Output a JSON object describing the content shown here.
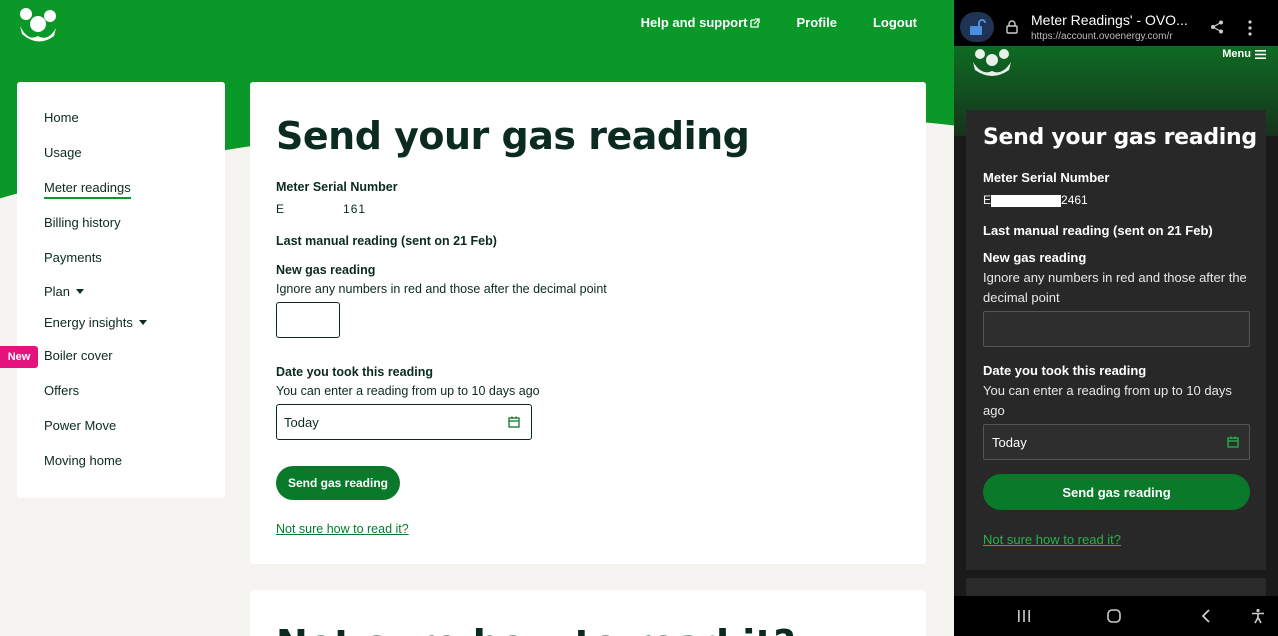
{
  "desktop": {
    "topnav": {
      "help": "Help and support",
      "profile": "Profile",
      "logout": "Logout"
    },
    "sidebar": {
      "items": [
        {
          "label": "Home"
        },
        {
          "label": "Usage"
        },
        {
          "label": "Meter readings"
        },
        {
          "label": "Billing history"
        },
        {
          "label": "Payments"
        },
        {
          "label": "Plan"
        },
        {
          "label": "Energy insights"
        },
        {
          "label": "Boiler cover"
        },
        {
          "label": "Offers"
        },
        {
          "label": "Power Move"
        },
        {
          "label": "Moving home"
        }
      ],
      "new_badge": "New"
    },
    "main": {
      "title": "Send your gas reading",
      "serial_label": "Meter Serial Number",
      "serial_start": "E",
      "serial_end": "161",
      "last_reading": "Last manual reading (sent on 21 Feb)",
      "new_reading_label": "New gas reading",
      "new_reading_hint": "Ignore any numbers in red and those after the decimal point",
      "date_label": "Date you took this reading",
      "date_hint": "You can enter a reading from up to 10 days ago",
      "date_value": "Today",
      "send_button": "Send gas reading",
      "help_link": "Not sure how to read it?",
      "next_card_title": "Not sure how to read it?"
    }
  },
  "mobile": {
    "browser": {
      "tab_title": "Meter Readings' - OVO...",
      "url": "https://account.ovoenergy.com/r"
    },
    "menu_label": "Menu",
    "main": {
      "title": "Send your gas reading",
      "serial_label": "Meter Serial Number",
      "serial_start": "E",
      "serial_end": "2461",
      "last_reading": "Last manual reading (sent on 21 Feb)",
      "new_reading_label": "New gas reading",
      "new_reading_hint": "Ignore any numbers in red and those after the decimal point",
      "date_label": "Date you took this reading",
      "date_hint": "You can enter a reading from up to 10 days ago",
      "date_value": "Today",
      "send_button": "Send gas reading",
      "help_link": "Not sure how to read it?"
    }
  },
  "colors": {
    "brand_green": "#0a9828",
    "button_green": "#0a7a2a",
    "badge_pink": "#e4127d"
  }
}
